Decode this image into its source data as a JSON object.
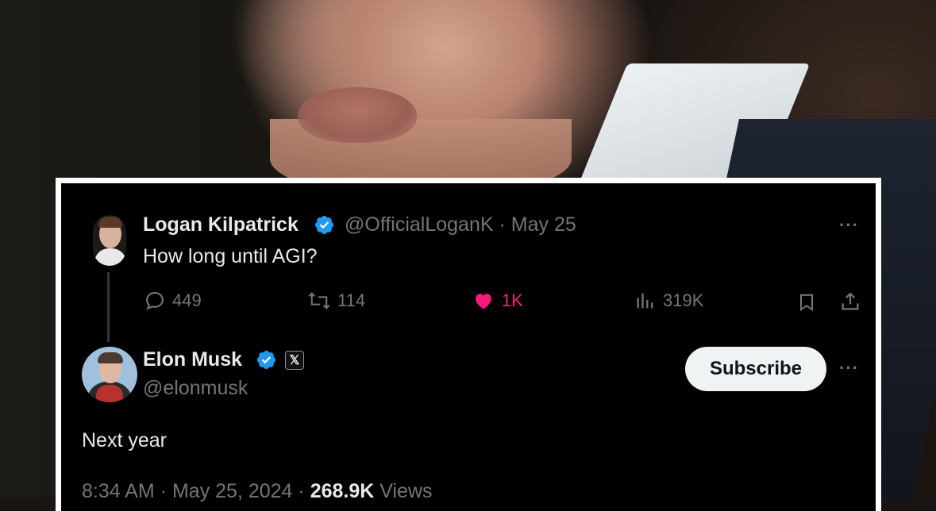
{
  "tweet_parent": {
    "author_name": "Logan Kilpatrick",
    "handle": "@OfficialLoganK",
    "separator": "·",
    "date": "May 25",
    "text": "How long until AGI?",
    "replies": "449",
    "reposts": "114",
    "likes": "1K",
    "views": "319K",
    "more": "···"
  },
  "tweet_main": {
    "author_name": "Elon Musk",
    "handle": "@elonmusk",
    "subscribe_label": "Subscribe",
    "more": "···",
    "affiliate_badge": "𝕏",
    "text": "Next year",
    "time": "8:34 AM",
    "sep1": "·",
    "date": "May 25, 2024",
    "sep2": "·",
    "views_count": "268.9K",
    "views_label": "Views"
  },
  "colors": {
    "verified_blue": "#1d9bf0",
    "like_pink": "#f91880",
    "muted_text": "#71767b",
    "primary_text": "#e7e9ea"
  }
}
